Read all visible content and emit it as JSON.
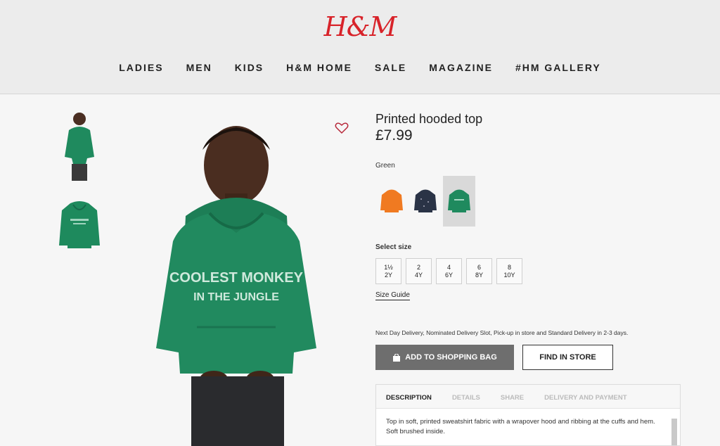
{
  "brand": {
    "logo_text": "H&M",
    "logo_color": "#d8232a"
  },
  "nav": {
    "items": [
      {
        "label": "LADIES"
      },
      {
        "label": "MEN"
      },
      {
        "label": "KIDS"
      },
      {
        "label": "H&M HOME"
      },
      {
        "label": "SALE"
      },
      {
        "label": "MAGAZINE"
      },
      {
        "label": "#HM GALLERY"
      }
    ]
  },
  "gallery": {
    "hoodie_print_line1": "COOLEST MONKEY",
    "hoodie_print_line2": "IN THE JUNGLE",
    "favorite_icon": "heart-outline-icon"
  },
  "product": {
    "title": "Printed hooded top",
    "price": "£7.99",
    "color_label": "Green",
    "swatches": [
      {
        "color": "orange",
        "hex": "#f07a21",
        "selected": false
      },
      {
        "color": "navy",
        "hex": "#2a3346",
        "selected": false
      },
      {
        "color": "green",
        "hex": "#1f8a5e",
        "selected": true
      }
    ],
    "size_label": "Select size",
    "sizes": [
      {
        "line1": "1½",
        "line2": "2Y"
      },
      {
        "line1": "2",
        "line2": "4Y"
      },
      {
        "line1": "4",
        "line2": "6Y"
      },
      {
        "line1": "6",
        "line2": "8Y"
      },
      {
        "line1": "8",
        "line2": "10Y"
      }
    ],
    "size_guide": "Size Guide",
    "delivery_text": "Next Day Delivery, Nominated Delivery Slot, Pick-up in store and Standard Delivery in 2-3 days.",
    "add_to_bag_label": "ADD TO SHOPPING BAG",
    "find_in_store_label": "FIND IN STORE",
    "tabs": [
      {
        "label": "DESCRIPTION",
        "active": true
      },
      {
        "label": "DETAILS",
        "active": false
      },
      {
        "label": "SHARE",
        "active": false
      },
      {
        "label": "DELIVERY AND PAYMENT",
        "active": false
      }
    ],
    "description": "Top in soft, printed sweatshirt fabric with a wrapover hood and ribbing at the cuffs and hem. Soft brushed inside."
  }
}
